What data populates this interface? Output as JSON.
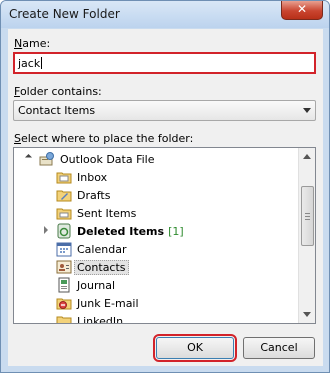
{
  "window": {
    "title": "Create New Folder",
    "close_glyph": "✕"
  },
  "name_field": {
    "label_prefix": "N",
    "label_rest": "ame:",
    "value": "jack"
  },
  "folder_contains": {
    "label_prefix": "F",
    "label_rest": "older contains:",
    "selected": "Contact Items"
  },
  "place_label": {
    "label_prefix": "S",
    "label_rest": "elect where to place the folder:"
  },
  "tree": {
    "root": {
      "label": "Outlook Data File",
      "icon": "mail-store-icon"
    },
    "items": [
      {
        "label": "Inbox",
        "icon": "inbox-folder-icon"
      },
      {
        "label": "Drafts",
        "icon": "drafts-folder-icon"
      },
      {
        "label": "Sent Items",
        "icon": "sent-folder-icon"
      },
      {
        "label": "Deleted Items",
        "count": "[1]",
        "icon": "deleted-items-icon"
      },
      {
        "label": "Calendar",
        "icon": "calendar-icon"
      },
      {
        "label": "Contacts",
        "icon": "contacts-icon"
      },
      {
        "label": "Journal",
        "icon": "journal-icon"
      },
      {
        "label": "Junk E-mail",
        "icon": "junk-folder-icon"
      },
      {
        "label": "LinkedIn",
        "icon": "linkedin-folder-icon"
      }
    ]
  },
  "buttons": {
    "ok": "OK",
    "cancel": "Cancel"
  },
  "colors": {
    "highlight_red": "#d2232a",
    "count_green": "#2e8b2e"
  }
}
